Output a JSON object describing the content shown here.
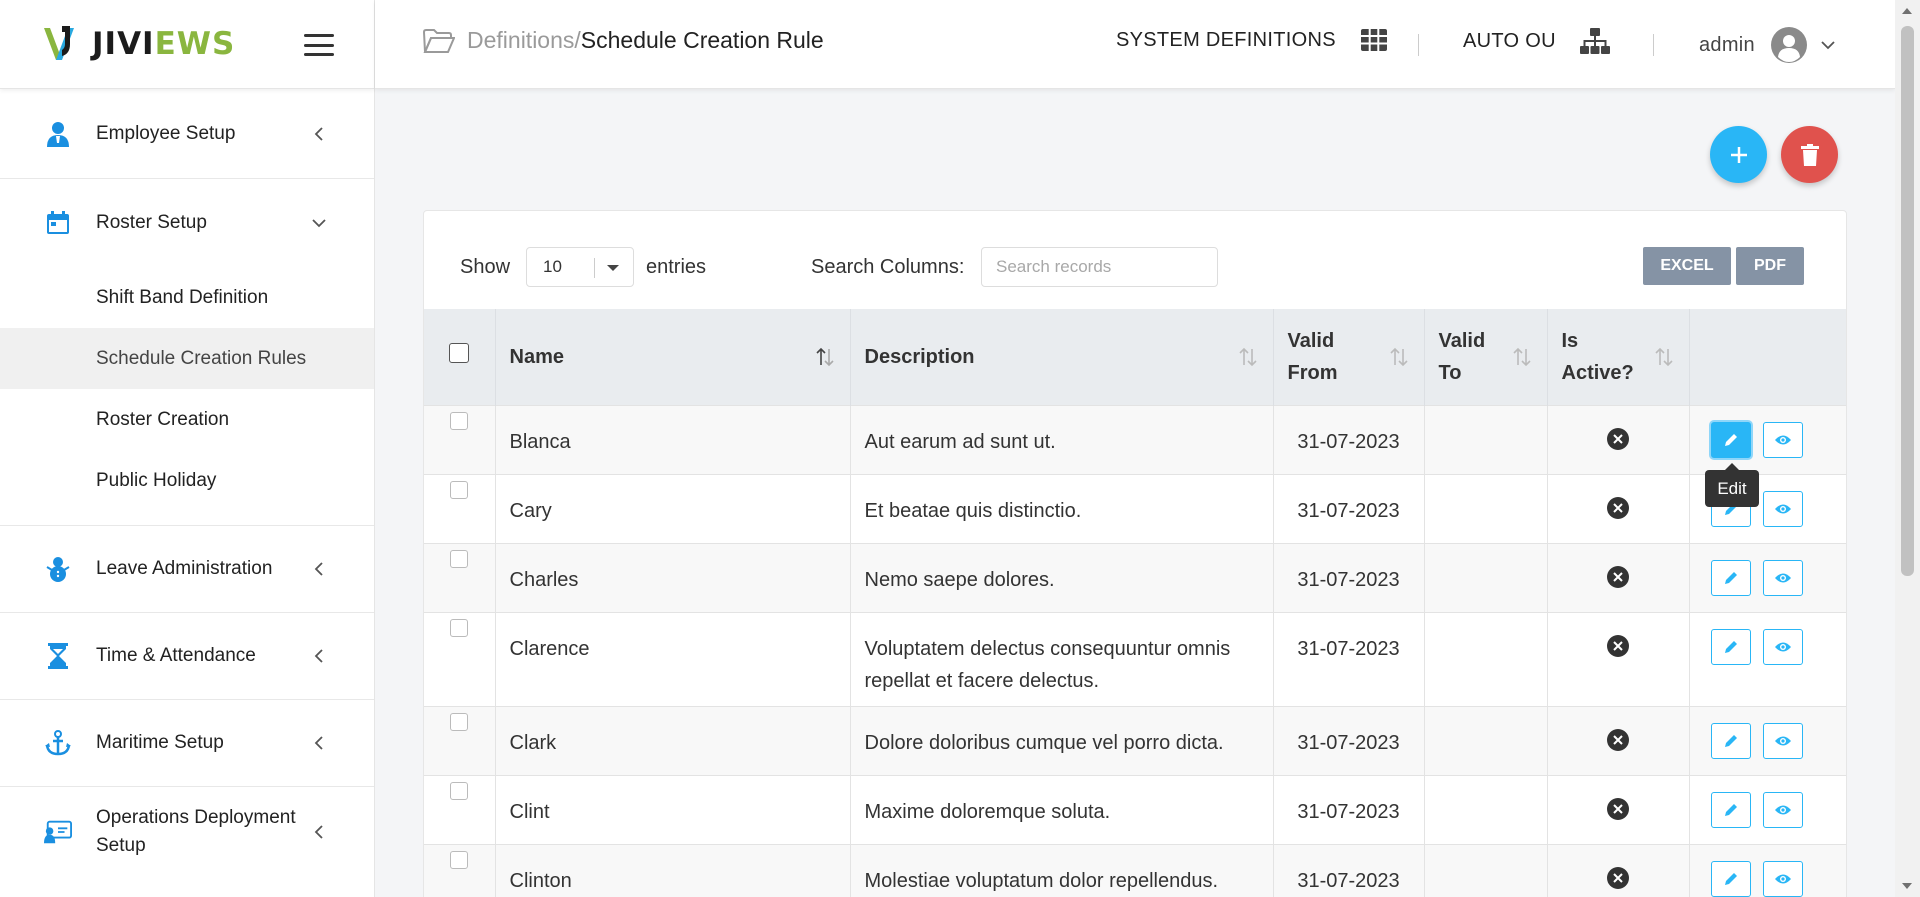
{
  "brand": {
    "name_part1": "JIVI",
    "name_part2": "EWS"
  },
  "breadcrumb": {
    "parent": "Definitions/",
    "current": "Schedule Creation Rule"
  },
  "topbar": {
    "system_definitions": "SYSTEM DEFINITIONS",
    "auto_ou": "AUTO OU",
    "user": "admin"
  },
  "sidebar": {
    "items": [
      {
        "label": "Employee Setup",
        "icon": "employee-icon"
      },
      {
        "label": "Roster Setup",
        "icon": "calendar-icon"
      },
      {
        "label": "Leave Administration",
        "icon": "snowman-icon"
      },
      {
        "label": "Time & Attendance",
        "icon": "hourglass-icon"
      },
      {
        "label": "Maritime Setup",
        "icon": "anchor-icon"
      },
      {
        "label": "Operations Deployment Setup",
        "icon": "deployment-icon"
      }
    ],
    "roster_sub": [
      "Shift Band Definition",
      "Schedule Creation Rules",
      "Roster Creation",
      "Public Holiday"
    ]
  },
  "controls": {
    "show": "Show",
    "entries_value": "10",
    "entries": "entries",
    "search_label": "Search Columns:",
    "search_placeholder": "Search records",
    "excel": "EXCEL",
    "pdf": "PDF"
  },
  "table": {
    "headers": {
      "name": "Name",
      "description": "Description",
      "valid_from": "Valid From",
      "valid_to": "Valid To",
      "is_active": "Is Active?"
    },
    "rows": [
      {
        "name": "Blanca",
        "description": "Aut earum ad sunt ut.",
        "valid_from": "31-07-2023",
        "valid_to": ""
      },
      {
        "name": "Cary",
        "description": "Et beatae quis distinctio.",
        "valid_from": "31-07-2023",
        "valid_to": ""
      },
      {
        "name": "Charles",
        "description": "Nemo saepe dolores.",
        "valid_from": "31-07-2023",
        "valid_to": ""
      },
      {
        "name": "Clarence",
        "description": "Voluptatem delectus consequuntur omnis repellat et facere delectus.",
        "valid_from": "31-07-2023",
        "valid_to": ""
      },
      {
        "name": "Clark",
        "description": "Dolore doloribus cumque vel porro dicta.",
        "valid_from": "31-07-2023",
        "valid_to": ""
      },
      {
        "name": "Clint",
        "description": "Maxime doloremque soluta.",
        "valid_from": "31-07-2023",
        "valid_to": ""
      },
      {
        "name": "Clinton",
        "description": "Molestiae voluptatum dolor repellendus.",
        "valid_from": "31-07-2023",
        "valid_to": ""
      }
    ]
  },
  "tooltip": "Edit",
  "colors": {
    "accent": "#29b6f6",
    "danger": "#e0524d",
    "export": "#8593a5",
    "brand_green": "#8ab63f"
  }
}
